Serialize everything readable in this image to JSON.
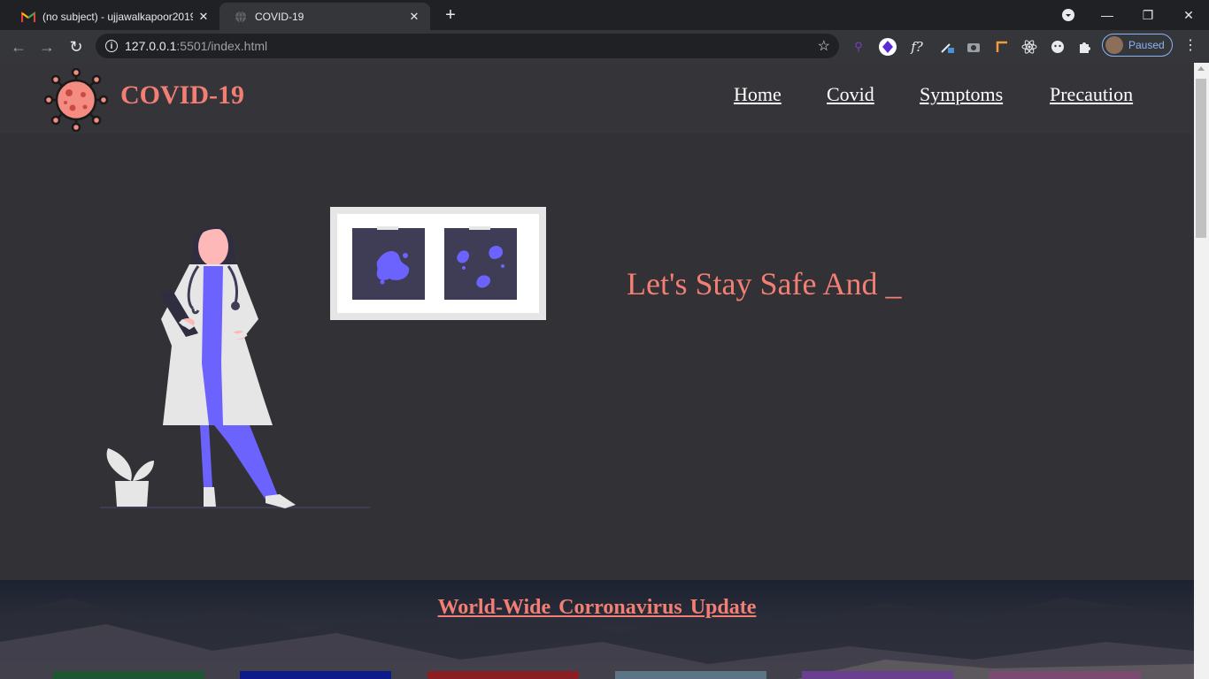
{
  "browser": {
    "tabs": [
      {
        "title": "(no subject) - ujjawalkapoor2019",
        "favicon": "gmail-icon",
        "active": false
      },
      {
        "title": "COVID-19",
        "favicon": "globe-icon",
        "active": true
      }
    ],
    "url_host": "127.0.0.1",
    "url_rest": ":5501/index.html",
    "profile_label": "Paused"
  },
  "site": {
    "brand": "COVID-19",
    "nav": [
      "Home",
      "Covid",
      "Symptoms",
      "Precaution"
    ],
    "tagline": "Let's Stay Safe And _",
    "update_title": "World-Wide Corronavirus Update",
    "colors": {
      "accent": "#f27e74",
      "background": "#323135",
      "illustration_purple": "#6c63ff"
    },
    "stat_card_colors": [
      "#1e5631",
      "#0d1a8a",
      "#8b1e22",
      "#5c7585",
      "#6b3f8f",
      "#7a4a70"
    ]
  }
}
